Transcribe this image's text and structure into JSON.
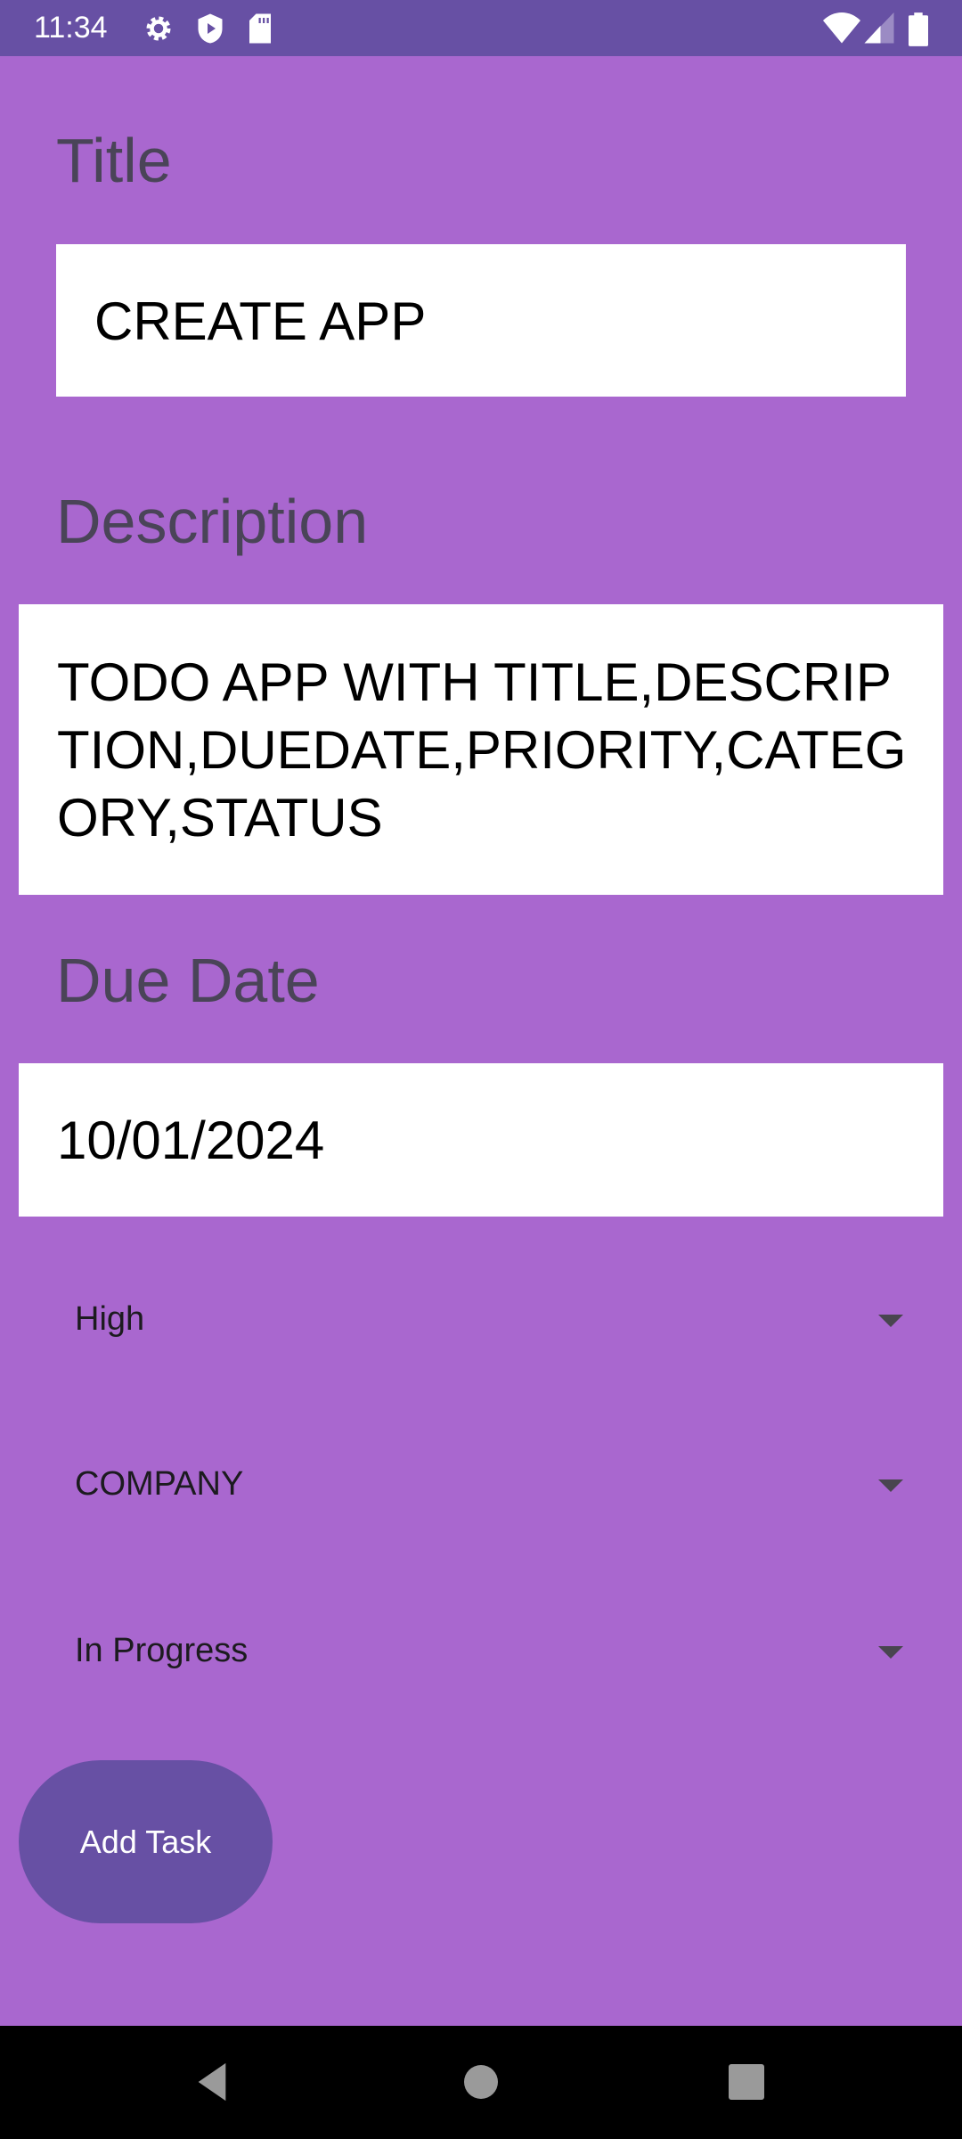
{
  "status_bar": {
    "time": "11:34"
  },
  "form": {
    "title_label": "Title",
    "title_value": "CREATE APP",
    "description_label": "Description",
    "description_value": "TODO APP WITH TITLE,DESCRIPTION,DUEDATE,PRIORITY,CATEGORY,STATUS",
    "due_date_label": "Due Date",
    "due_date_value": "10/01/2024",
    "priority_selected": "High",
    "category_selected": "COMPANY",
    "status_selected": "In Progress",
    "add_button": "Add Task"
  },
  "colors": {
    "background": "#A967CF",
    "accent": "#6750A4"
  }
}
